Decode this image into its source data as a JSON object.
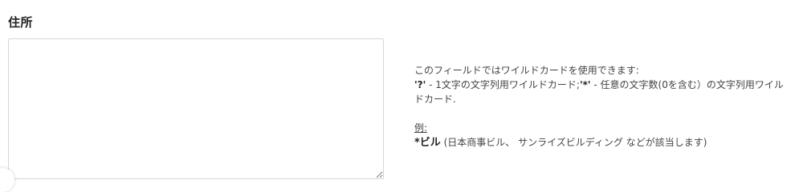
{
  "field": {
    "label": "住所",
    "value": "",
    "placeholder": ""
  },
  "help": {
    "intro": "このフィールドではワイルドカードを使用できます:",
    "wildcard_q": "'?'",
    "wildcard_q_desc": " - 1文字の文字列用ワイルドカード;",
    "wildcard_star": "'*'",
    "wildcard_star_desc": " - 任意の文字数(0を含む）の文字列用ワイルドカード.",
    "example_heading": "例:",
    "example_term": "*ビル",
    "example_desc": "  (日本商事ビル、 サンライズビルディング などが該当します)"
  }
}
